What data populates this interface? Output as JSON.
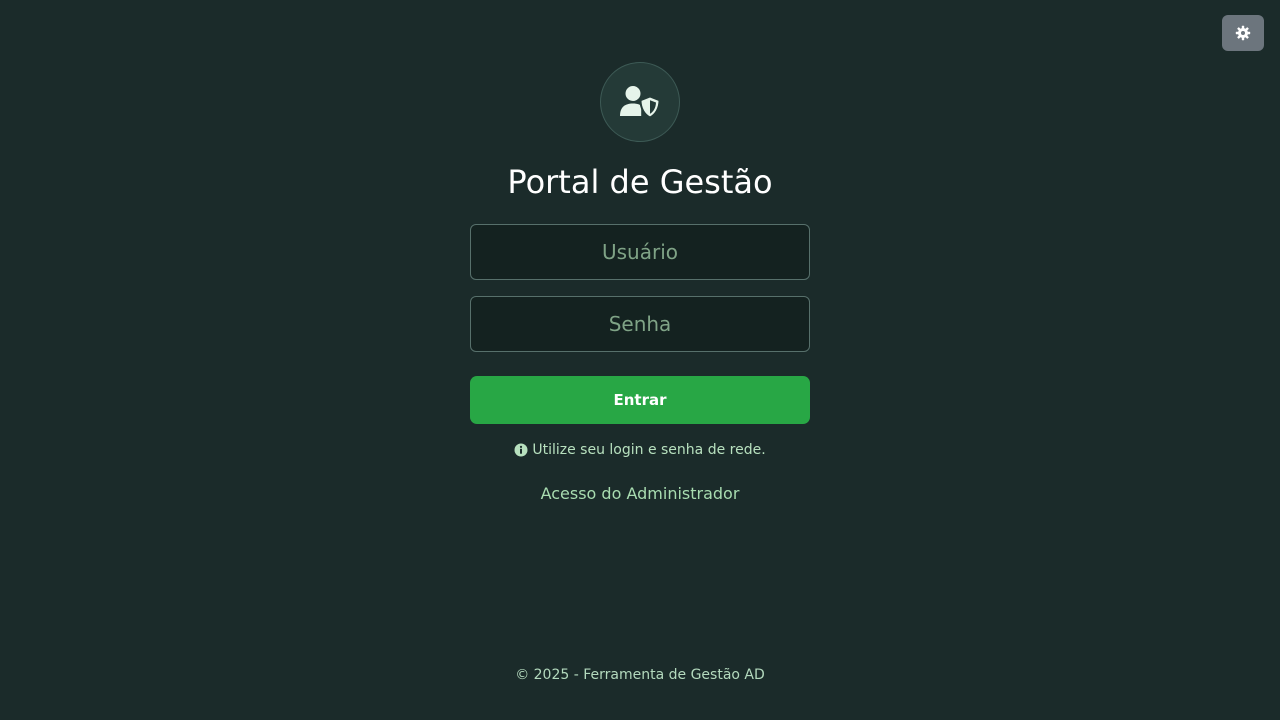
{
  "theme_toggle": {
    "icon": "gear-icon"
  },
  "logo": {
    "icon": "user-shield-icon"
  },
  "title": "Portal de Gestão",
  "form": {
    "username_placeholder": "Usuário",
    "username_value": "",
    "password_placeholder": "Senha",
    "password_value": "",
    "submit_label": "Entrar"
  },
  "hint": {
    "icon": "info-circle-icon",
    "text": "Utilize seu login e senha de rede."
  },
  "admin_link": "Acesso do Administrador",
  "footer": "© 2025 - Ferramenta de Gestão AD",
  "colors": {
    "background": "#1b2b2a",
    "primary_button": "#28a745",
    "toggle_button": "#6c757d",
    "accent_text": "#a8dcb0"
  }
}
